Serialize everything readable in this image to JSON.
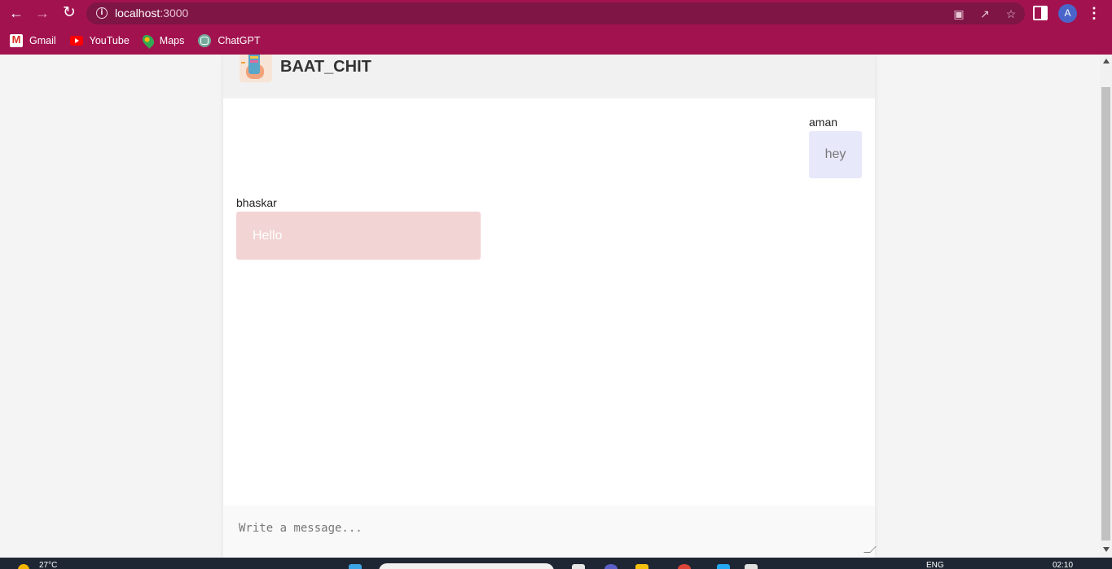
{
  "browser": {
    "url_host": "localhost",
    "url_port": ":3000",
    "avatar_initial": "A",
    "bookmarks": [
      {
        "label": "Gmail",
        "icon": "gmail-icon"
      },
      {
        "label": "YouTube",
        "icon": "youtube-icon"
      },
      {
        "label": "Maps",
        "icon": "maps-icon"
      },
      {
        "label": "ChatGPT",
        "icon": "chatgpt-icon"
      }
    ],
    "theme_color": "#a2124f"
  },
  "app": {
    "title": "BAAT_CHIT"
  },
  "messages": [
    {
      "sender": "aman",
      "text": "hey",
      "side": "right",
      "bubble_color": "#e8e8fb"
    },
    {
      "sender": "bhaskar",
      "text": "Hello",
      "side": "left",
      "bubble_color": "#f2d4d4"
    }
  ],
  "composer": {
    "placeholder": "Write a message..."
  },
  "taskbar": {
    "temperature": "27°C",
    "language": "ENG",
    "time": "02:10"
  }
}
